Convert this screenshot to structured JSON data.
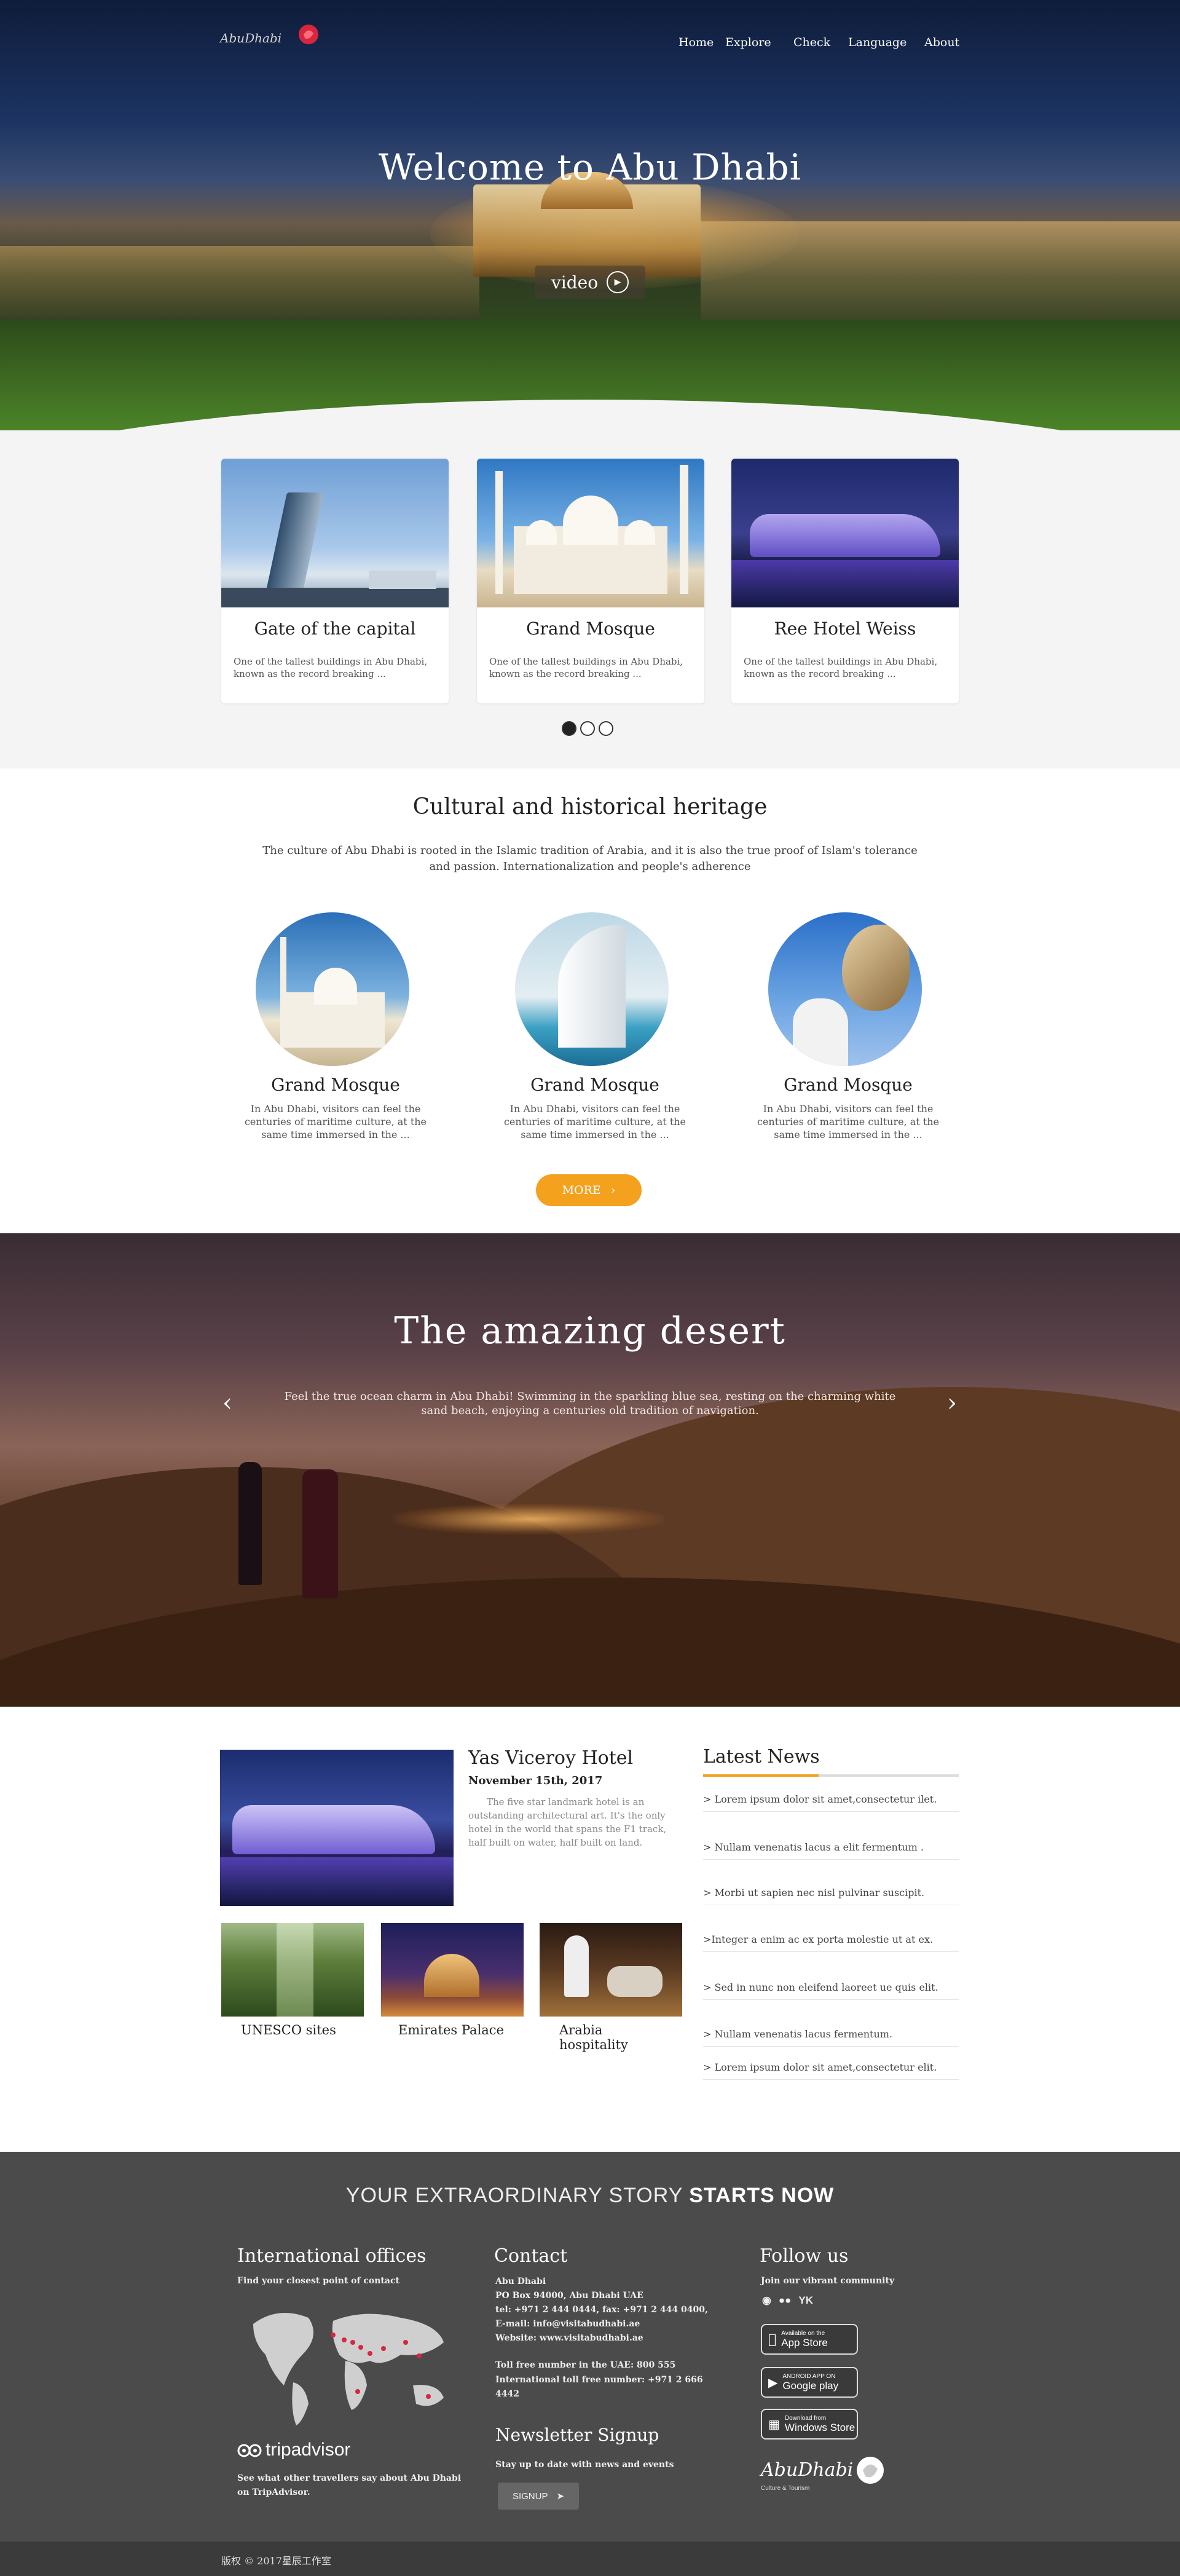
{
  "header": {
    "logo_text": "AbuDhabi",
    "nav": [
      "Home",
      "Explore",
      "Check",
      "Language",
      "About"
    ]
  },
  "hero": {
    "title": "Welcome to Abu Dhabi",
    "video_label": "video"
  },
  "cards": [
    {
      "title": "Gate of the capital",
      "text": "One of the tallest buildings in Abu Dhabi, known as the record breaking ..."
    },
    {
      "title": "Grand Mosque",
      "text": "One of the tallest buildings in Abu Dhabi, known as the record breaking ..."
    },
    {
      "title": "Ree Hotel Weiss",
      "text": "One of the tallest buildings in Abu Dhabi, known as the record breaking ..."
    }
  ],
  "carousel": {
    "count": 3,
    "active": 0
  },
  "heritage": {
    "title": "Cultural and historical heritage",
    "intro": "The culture of Abu Dhabi is rooted in the Islamic tradition of Arabia, and it is also the true proof of Islam's tolerance and passion. Internationalization and people's adherence",
    "items": [
      {
        "title": "Grand Mosque",
        "text": "In Abu Dhabi, visitors can feel the centuries of maritime culture, at the same time immersed in the ..."
      },
      {
        "title": "Grand Mosque",
        "text": "In Abu Dhabi, visitors can feel the centuries of maritime culture, at the same time immersed in the ..."
      },
      {
        "title": "Grand Mosque",
        "text": "In Abu Dhabi, visitors can feel the centuries of maritime culture, at the same time immersed in the ..."
      }
    ],
    "more_label": "MORE"
  },
  "desert": {
    "title": "The amazing desert",
    "text": "Feel the true ocean charm in Abu Dhabi! Swimming in the sparkling blue sea, resting on the charming white sand beach, enjoying a centuries old tradition of navigation."
  },
  "featured": {
    "title": "Yas Viceroy Hotel",
    "date": "November 15th, 2017",
    "text": "The five star landmark hotel is an outstanding architectural art. It's the only hotel in the world that spans the F1 track, half built on water, half built on land."
  },
  "thumbs": [
    {
      "label": "UNESCO sites"
    },
    {
      "label": "Emirates Palace"
    },
    {
      "label": "Arabia hospitality"
    }
  ],
  "news": {
    "title": "Latest News",
    "items": [
      "Lorem ipsum dolor sit amet,consectetur ilet.",
      "Nullam venenatis lacus a elit fermentum .",
      "Morbi ut sapien nec nisl pulvinar suscipit.",
      ">Integer a enim ac ex porta molestie ut at ex.",
      "Sed in nunc non eleifend laoreet ue quis elit.",
      "Nullam venenatis lacus fermentum.",
      "Lorem ipsum dolor sit amet,consectetur elit."
    ]
  },
  "footer": {
    "banner_normal": "YOUR EXTRAORDINARY STORY ",
    "banner_bold": "STARTS NOW",
    "offices": {
      "title": "International offices",
      "subtitle": "Find your closest point of contact",
      "tripadvisor": "tripadvisor",
      "trip_text": "See what other travellers say about Abu Dhabi on TripAdvisor."
    },
    "contact": {
      "title": "Contact",
      "lines": [
        "Abu Dhabi",
        "PO Box 94000, Abu Dhabi UAE",
        "tel: +971 2 444 0444, fax: +971 2 444 0400,",
        "E-mail: info@visitabudhabi.ae",
        "Website: www.visitabudhabi.ae"
      ],
      "toll": "Toll free number in the UAE: 800 555",
      "intl_toll": "International toll free number: +971 2 666 4442"
    },
    "newsletter": {
      "title": "Newsletter Signup",
      "text": "Stay up to date with news and events",
      "button": "SIGNUP"
    },
    "follow": {
      "title": "Follow us",
      "subtitle": "Join our vibrant community",
      "social": [
        "weibo-icon",
        "wechat-icon",
        "youku-icon"
      ],
      "stores": [
        {
          "small": "Available on the",
          "big": "App Store"
        },
        {
          "small": "ANDROID APP ON",
          "big": "Google play"
        },
        {
          "small": "Download from",
          "big": "Windows Store"
        }
      ],
      "logo_text": "AbuDhabi",
      "logo_sub": "Culture & Tourism"
    },
    "copyright": "版权 © 2017星辰工作室"
  },
  "colors": {
    "accent": "#f4a11e",
    "footer_bg": "#4b4b4b",
    "copyright_bg": "#3b3b3b"
  }
}
